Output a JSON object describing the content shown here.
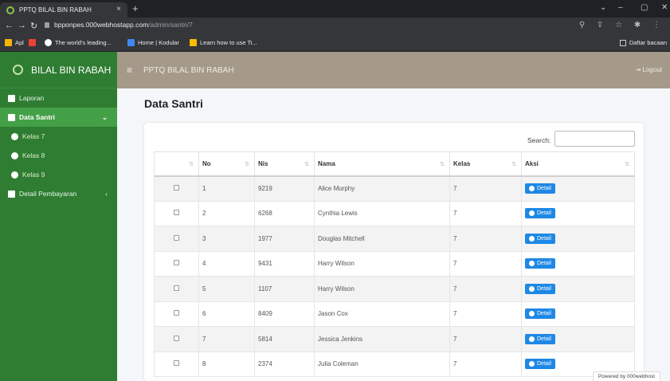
{
  "browser": {
    "tab_title": "PPTQ BILAL BIN RABAH",
    "tab_close": "×",
    "new_tab": "+",
    "url_host": "bpponpes.000webhostapp.com",
    "url_path": "/admin/santri/7",
    "bookmarks": [
      {
        "label": "Apl",
        "color": "#f4b400"
      },
      {
        "label": "",
        "color": "#ea4335"
      },
      {
        "label": "The world's leading...",
        "color": "#ffffff"
      },
      {
        "label": "Home | Kodular",
        "color": "#4285f4"
      },
      {
        "label": "Learn how to use Ti...",
        "color": "#fbbc05"
      }
    ],
    "bookmark_right": "Daftar bacaan"
  },
  "app": {
    "brand": "BILAL BIN RABAH",
    "title": "PPTQ BILAL BIN RABAH",
    "logout": "Logout"
  },
  "sidebar": {
    "items": [
      {
        "label": "Laporan"
      },
      {
        "label": "Data Santri",
        "arrow": "⌄"
      },
      {
        "label": "Kelas 7"
      },
      {
        "label": "Kelas 8"
      },
      {
        "label": "Kelas 9"
      },
      {
        "label": "Detail Pembayaran",
        "arrow": "‹"
      }
    ]
  },
  "main": {
    "page_title": "Data Santri",
    "search_label": "Search:",
    "search_value": ""
  },
  "table": {
    "headers": [
      "No",
      "Nis",
      "Nama",
      "Kelas",
      "Aksi"
    ],
    "action_label": "Detail",
    "rows": [
      {
        "no": "1",
        "nis": "9219",
        "nama": "Alice Murphy",
        "kelas": "7"
      },
      {
        "no": "2",
        "nis": "6268",
        "nama": "Cynthia Lewis",
        "kelas": "7"
      },
      {
        "no": "3",
        "nis": "1977",
        "nama": "Douglas Mitchell",
        "kelas": "7"
      },
      {
        "no": "4",
        "nis": "9431",
        "nama": "Harry Wilson",
        "kelas": "7"
      },
      {
        "no": "5",
        "nis": "1107",
        "nama": "Harry Wilson",
        "kelas": "7"
      },
      {
        "no": "6",
        "nis": "8409",
        "nama": "Jason Cox",
        "kelas": "7"
      },
      {
        "no": "7",
        "nis": "5814",
        "nama": "Jessica Jenkins",
        "kelas": "7"
      },
      {
        "no": "8",
        "nis": "2374",
        "nama": "Julia Coleman",
        "kelas": "7"
      }
    ]
  },
  "footer": {
    "powered": "Powered by 000webhost"
  }
}
